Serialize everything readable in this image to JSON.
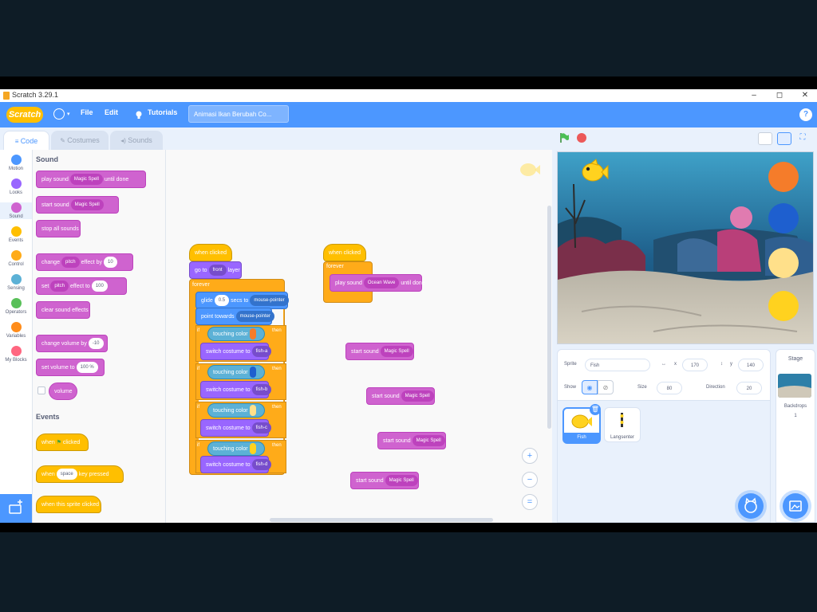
{
  "window": {
    "title": "Scratch 3.29.1",
    "minimize": "–",
    "maximize": "◻",
    "close": "✕"
  },
  "menubar": {
    "logo": "Scratch",
    "file": "File",
    "edit": "Edit",
    "tutorials": "Tutorials",
    "project_name": "Animasi Ikan Berubah Co...",
    "help": "?"
  },
  "tabs": {
    "code": "Code",
    "costumes": "Costumes",
    "sounds": "Sounds"
  },
  "categories": [
    {
      "label": "Motion",
      "color": "#4c97ff"
    },
    {
      "label": "Looks",
      "color": "#9966ff"
    },
    {
      "label": "Sound",
      "color": "#cf63cf"
    },
    {
      "label": "Events",
      "color": "#ffbf00"
    },
    {
      "label": "Control",
      "color": "#ffab19"
    },
    {
      "label": "Sensing",
      "color": "#5cb1d6"
    },
    {
      "label": "Operators",
      "color": "#59c059"
    },
    {
      "label": "Variables",
      "color": "#ff8c1a"
    },
    {
      "label": "My Blocks",
      "color": "#ff6680"
    }
  ],
  "palette": {
    "sound_header": "Sound",
    "play_sound": "play sound",
    "start_sound": "start sound",
    "sound_name": "Magic Spell",
    "until_done": "until done",
    "stop_all": "stop all sounds",
    "change": "change",
    "set": "set",
    "pitch": "pitch",
    "effect_by": "effect by",
    "effect_to": "effect to",
    "ten": "10",
    "hundred": "100",
    "clear_effects": "clear sound effects",
    "change_volume": "change volume by",
    "minus_ten": "-10",
    "set_volume": "set volume to",
    "volume_pct": "100 %",
    "volume": "volume",
    "events_header": "Events",
    "when": "when",
    "clicked": "clicked",
    "space": "space",
    "key_pressed": "key pressed",
    "sprite_clicked": "when this sprite clicked"
  },
  "script1": {
    "hat": "when  clicked",
    "goto": "go to",
    "goto_target": "front",
    "goto_suffix": "layer",
    "forever": "forever",
    "glide": "glide",
    "glide_secs": "0.5",
    "glide_to": "secs to",
    "glide_target": "mouse-pointer",
    "point": "point towards",
    "point_target": "mouse-pointer",
    "if": "if",
    "touching": "touching color",
    "then": "then",
    "switch": "switch costume to",
    "costumes": [
      "fish-a",
      "fish-b",
      "fish-c",
      "fish-d"
    ],
    "colors": [
      "#f57c2a",
      "#1e5fcf",
      "#ffe08a",
      "#ffd21f"
    ]
  },
  "script2": {
    "hat": "when  clicked",
    "forever": "forever",
    "play": "play sound",
    "sound": "Ocean Wave",
    "until": "until done"
  },
  "loose_blocks": {
    "start": "start sound",
    "sound": "Magic Spell"
  },
  "zoom": {
    "in": "+",
    "out": "−",
    "reset": "="
  },
  "sprite": {
    "sprite_label": "Sprite",
    "sprite_name": "Fish",
    "x_label": "x",
    "x_value": "170",
    "y_label": "y",
    "y_value": "140",
    "show_label": "Show",
    "size_label": "Size",
    "size_value": "80",
    "direction_label": "Direction",
    "direction_value": "20",
    "thumb1": "Fish",
    "thumb2": "Langsenter"
  },
  "stage_pane": {
    "label": "Stage",
    "backdrops_label": "Backdrops",
    "backdrops_count": "1"
  },
  "stage_circles": [
    "#f57c2a",
    "#1e5fcf",
    "#ffe08a",
    "#ffd21f"
  ]
}
